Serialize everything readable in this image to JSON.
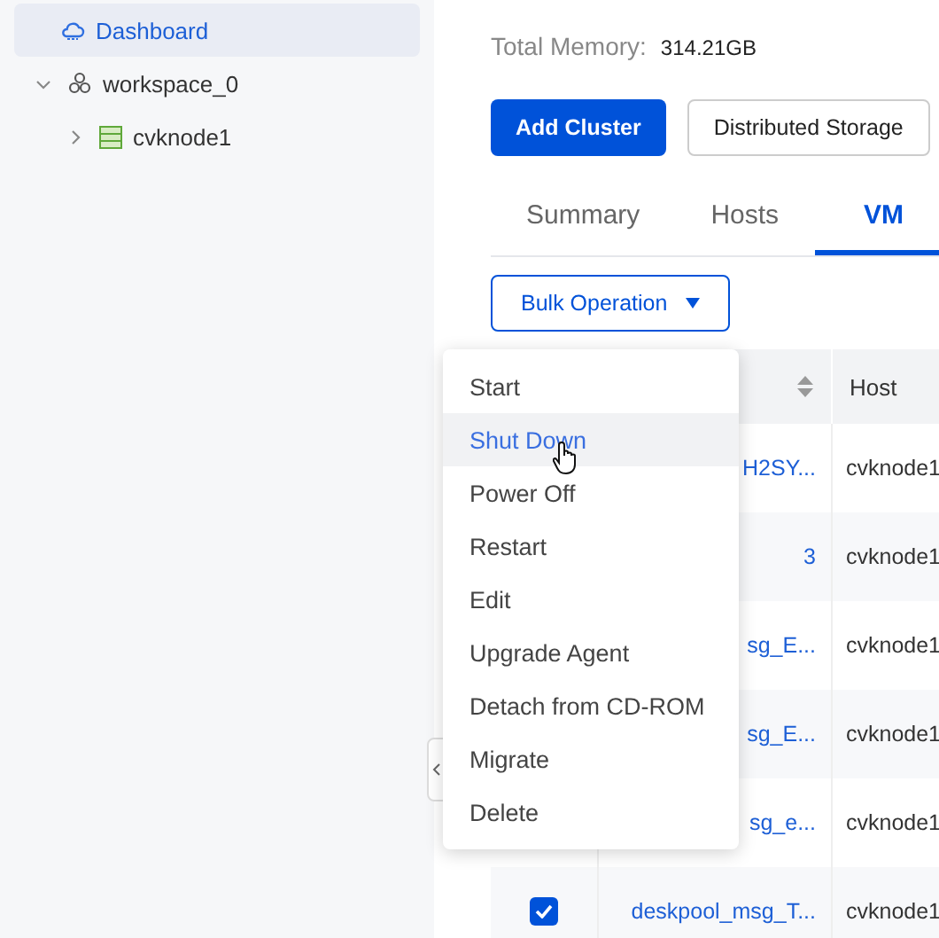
{
  "sidebar": {
    "items": [
      {
        "label": "Dashboard",
        "selected": true,
        "kind": "dashboard"
      },
      {
        "label": "workspace_0",
        "selected": false,
        "expanded": true,
        "kind": "cluster",
        "children": [
          {
            "label": "cvknode1",
            "selected": false,
            "expanded": false,
            "kind": "host"
          }
        ]
      }
    ]
  },
  "summary": [
    {
      "label": "Total Memory:",
      "value": "314.21GB"
    }
  ],
  "buttons": [
    {
      "label": "Add Cluster",
      "kind": "primary"
    },
    {
      "label": "Distributed Storage",
      "kind": "default"
    }
  ],
  "tabs": [
    {
      "label": "Summary",
      "selected": false
    },
    {
      "label": "Hosts",
      "selected": false
    },
    {
      "label": "VM",
      "selected": true
    }
  ],
  "bulk_button": {
    "label": "Bulk Operation"
  },
  "table": {
    "columns": [
      {
        "sortable": true
      },
      {
        "label": "Host",
        "sortable": false
      }
    ],
    "rows": [
      {
        "name": "H2SY...",
        "host": "cvknode1"
      },
      {
        "name": "3",
        "host": "cvknode1"
      },
      {
        "name": "sg_E...",
        "host": "cvknode1"
      },
      {
        "name": "sg_E...",
        "host": "cvknode1"
      },
      {
        "name": "sg_e...",
        "host": "cvknode1"
      },
      {
        "name": "deskpool_msg_T...",
        "host": "cvknode1",
        "checked": true
      }
    ]
  },
  "menu": {
    "items": [
      {
        "label": "Start",
        "selected": false
      },
      {
        "label": "Shut Down",
        "selected": true
      },
      {
        "label": "Power Off",
        "selected": false
      },
      {
        "label": "Restart",
        "selected": false
      },
      {
        "label": "Edit",
        "selected": false
      },
      {
        "label": "Upgrade Agent",
        "selected": false
      },
      {
        "label": "Detach from CD-ROM",
        "selected": false
      },
      {
        "label": "Migrate",
        "selected": false
      },
      {
        "label": "Delete",
        "selected": false
      }
    ]
  }
}
